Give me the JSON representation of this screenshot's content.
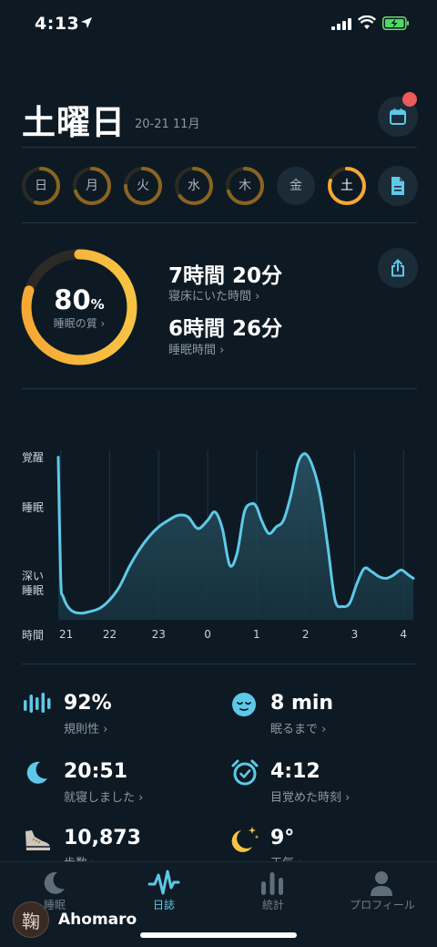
{
  "status_bar": {
    "time": "4:13"
  },
  "header": {
    "title": "土曜日",
    "date_range": "20-21 11月"
  },
  "days": [
    {
      "label": "日",
      "progress": 0.55,
      "active": false
    },
    {
      "label": "月",
      "progress": 0.7,
      "active": false
    },
    {
      "label": "火",
      "progress": 0.75,
      "active": false
    },
    {
      "label": "水",
      "progress": 0.65,
      "active": false
    },
    {
      "label": "木",
      "progress": 0.7,
      "active": false
    },
    {
      "label": "金",
      "progress": 0,
      "active": false
    },
    {
      "label": "土",
      "progress": 0.8,
      "active": true
    }
  ],
  "summary": {
    "quality_value": "80",
    "quality_unit": "%",
    "quality_fraction": 0.8,
    "quality_label": "睡眠の質 ›",
    "in_bed_value": "7時間 20分",
    "in_bed_label": "寝床にいた時間 ›",
    "asleep_value": "6時間 26分",
    "asleep_label": "睡眠時間 ›"
  },
  "chart_data": {
    "type": "area",
    "y_levels": [
      "覚醒",
      "睡眠",
      "深い睡眠"
    ],
    "x_axis_label": "時間",
    "x_ticks": [
      "21",
      "22",
      "23",
      "0",
      "1",
      "2",
      "3",
      "4"
    ],
    "x": [
      20.95,
      21.0,
      21.05,
      21.2,
      21.4,
      21.6,
      21.8,
      22.0,
      22.2,
      22.4,
      22.6,
      22.8,
      23.0,
      23.2,
      23.4,
      23.6,
      23.8,
      0.0,
      0.15,
      0.3,
      0.45,
      0.6,
      0.75,
      0.9,
      1.0,
      1.1,
      1.25,
      1.4,
      1.55,
      1.7,
      1.85,
      2.0,
      2.15,
      2.3,
      2.45,
      2.6,
      2.75,
      2.9,
      3.05,
      3.2,
      3.35,
      3.5,
      3.65,
      3.8,
      3.95,
      4.1,
      4.2
    ],
    "values": [
      0.98,
      0.25,
      0.14,
      0.06,
      0.04,
      0.05,
      0.07,
      0.12,
      0.2,
      0.32,
      0.42,
      0.5,
      0.56,
      0.6,
      0.63,
      0.62,
      0.55,
      0.6,
      0.65,
      0.55,
      0.33,
      0.4,
      0.65,
      0.7,
      0.68,
      0.6,
      0.52,
      0.56,
      0.6,
      0.75,
      0.95,
      1.0,
      0.92,
      0.75,
      0.45,
      0.12,
      0.08,
      0.1,
      0.22,
      0.31,
      0.29,
      0.26,
      0.25,
      0.27,
      0.3,
      0.27,
      0.25
    ]
  },
  "metrics": [
    {
      "value": "92%",
      "label": "規則性 ›",
      "icon": "regularity-bars-icon"
    },
    {
      "value": "8 min",
      "label": "眠るまで ›",
      "icon": "sleepy-face-icon"
    },
    {
      "value": "20:51",
      "label": "就寝しました ›",
      "icon": "moon-icon"
    },
    {
      "value": "4:12",
      "label": "目覚めた時刻 ›",
      "icon": "alarm-clock-icon"
    },
    {
      "value": "10,873",
      "label": "歩数 ›",
      "icon": "shoe-icon"
    },
    {
      "value": "9°",
      "label": "天気 ›",
      "icon": "moon-stars-weather-icon"
    }
  ],
  "tabs": [
    {
      "label": "睡眠",
      "active": false
    },
    {
      "label": "日誌",
      "active": true
    },
    {
      "label": "統計",
      "active": false
    },
    {
      "label": "プロフィール",
      "active": false
    }
  ],
  "user": {
    "avatar_glyph": "鞠",
    "name": "Ahomaro"
  },
  "colors": {
    "accent_orange": "#f6a835",
    "accent_blue": "#5fc8e8",
    "background": "#0d1a24",
    "notification": "#ec5a5e"
  }
}
